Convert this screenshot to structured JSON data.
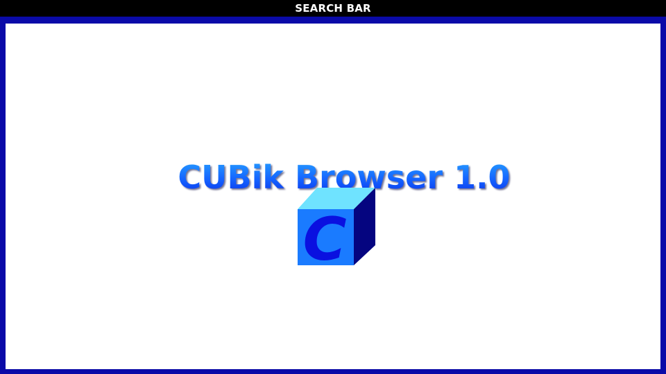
{
  "search_bar": {
    "label": "SEARCH BAR"
  },
  "splash": {
    "title": "CUBik Browser 1.0",
    "logo_letter": "C"
  },
  "colors": {
    "frame": "#0a0aa8",
    "top_bar": "#000000",
    "title_light": "#2aa9ff",
    "title_dark": "#0a2ce6",
    "cube_front": "#1a7bff",
    "cube_top": "#6fe3ff",
    "cube_side": "#050580",
    "logo_letter": "#0a10e0"
  },
  "icons": {
    "logo": "cube-logo-icon"
  }
}
